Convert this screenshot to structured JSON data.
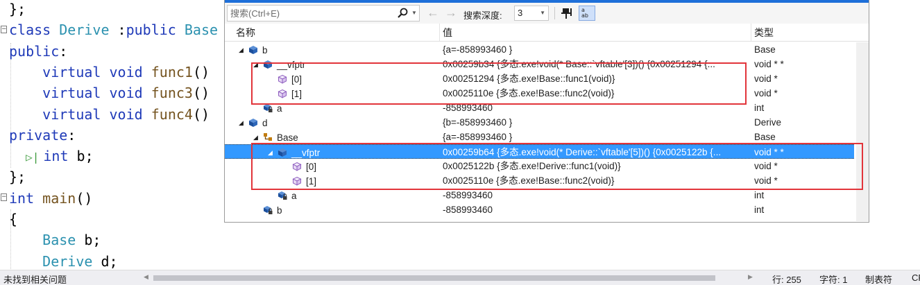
{
  "editor": {
    "lines": [
      [
        {
          "t": "};",
          "c": ""
        }
      ],
      [
        {
          "t": "class ",
          "c": "kw"
        },
        {
          "t": "Derive",
          "c": "tp"
        },
        {
          "t": " :",
          "c": ""
        },
        {
          "t": "public",
          "c": "kw"
        },
        {
          "t": " ",
          "c": ""
        },
        {
          "t": "Base",
          "c": "tp"
        }
      ],
      [
        {
          "t": "public",
          "c": "kw"
        },
        {
          "t": ":",
          "c": ""
        }
      ],
      [
        {
          "t": "    ",
          "c": ""
        },
        {
          "t": "virtual",
          "c": "kw"
        },
        {
          "t": " ",
          "c": ""
        },
        {
          "t": "void",
          "c": "kw"
        },
        {
          "t": " ",
          "c": ""
        },
        {
          "t": "func1",
          "c": "fn"
        },
        {
          "t": "()",
          "c": ""
        }
      ],
      [
        {
          "t": "    ",
          "c": ""
        },
        {
          "t": "virtual",
          "c": "kw"
        },
        {
          "t": " ",
          "c": ""
        },
        {
          "t": "void",
          "c": "kw"
        },
        {
          "t": " ",
          "c": ""
        },
        {
          "t": "func3",
          "c": "fn"
        },
        {
          "t": "()",
          "c": ""
        }
      ],
      [
        {
          "t": "    ",
          "c": ""
        },
        {
          "t": "virtual",
          "c": "kw"
        },
        {
          "t": " ",
          "c": ""
        },
        {
          "t": "void",
          "c": "kw"
        },
        {
          "t": " ",
          "c": ""
        },
        {
          "t": "func4",
          "c": "fn"
        },
        {
          "t": "()",
          "c": ""
        }
      ],
      [
        {
          "t": "private",
          "c": "kw"
        },
        {
          "t": ":",
          "c": ""
        }
      ],
      [
        {
          "t": "  ",
          "c": ""
        },
        {
          "t": "▷|",
          "c": "bm"
        },
        {
          "t": "int",
          "c": "kw"
        },
        {
          "t": " b;",
          "c": ""
        }
      ],
      [
        {
          "t": "};",
          "c": ""
        }
      ],
      [
        {
          "t": "int",
          "c": "kw"
        },
        {
          "t": " ",
          "c": ""
        },
        {
          "t": "main",
          "c": "fn"
        },
        {
          "t": "()",
          "c": ""
        }
      ],
      [
        {
          "t": "{",
          "c": ""
        }
      ],
      [
        {
          "t": "    ",
          "c": ""
        },
        {
          "t": "Base",
          "c": "tp"
        },
        {
          "t": " b;",
          "c": ""
        }
      ],
      [
        {
          "t": "    ",
          "c": ""
        },
        {
          "t": "Derive",
          "c": "tp"
        },
        {
          "t": " d;",
          "c": ""
        }
      ]
    ]
  },
  "watch": {
    "search_placeholder": "搜索(Ctrl+E)",
    "depth_label": "搜索深度:",
    "depth_value": "3",
    "columns": {
      "name": "名称",
      "value": "值",
      "type": "类型"
    },
    "rows": [
      {
        "indent": 0,
        "expander": "◢",
        "icon": "object-icon",
        "name": "b",
        "value": "{a=-858993460 }",
        "type": "Base",
        "selected": false
      },
      {
        "indent": 1,
        "expander": "◢",
        "icon": "object-icon",
        "name": "__vfptr",
        "value": "0x00259b34 {多态.exe!void(* Base::`vftable'[3])() {0x00251294 {...",
        "type": "void * *",
        "selected": false
      },
      {
        "indent": 2,
        "expander": "",
        "icon": "cube-icon",
        "name": "[0]",
        "value": "0x00251294 {多态.exe!Base::func1(void)}",
        "type": "void *",
        "selected": false
      },
      {
        "indent": 2,
        "expander": "",
        "icon": "cube-icon",
        "name": "[1]",
        "value": "0x0025110e {多态.exe!Base::func2(void)}",
        "type": "void *",
        "selected": false
      },
      {
        "indent": 1,
        "expander": "",
        "icon": "private-field-icon",
        "name": "a",
        "value": "-858993460",
        "type": "int",
        "selected": false
      },
      {
        "indent": 0,
        "expander": "◢",
        "icon": "object-icon",
        "name": "d",
        "value": "{b=-858993460 }",
        "type": "Derive",
        "selected": false
      },
      {
        "indent": 1,
        "expander": "◢",
        "icon": "base-class-icon",
        "name": "Base",
        "value": "{a=-858993460 }",
        "type": "Base",
        "selected": false
      },
      {
        "indent": 2,
        "expander": "◢",
        "icon": "object-icon",
        "name": "__vfptr",
        "value": "0x00259b64 {多态.exe!void(* Derive::`vftable'[5])() {0x0025122b {...",
        "type": "void * *",
        "selected": true
      },
      {
        "indent": 3,
        "expander": "",
        "icon": "cube-icon",
        "name": "[0]",
        "value": "0x0025122b {多态.exe!Derive::func1(void)}",
        "type": "void *",
        "selected": false
      },
      {
        "indent": 3,
        "expander": "",
        "icon": "cube-icon",
        "name": "[1]",
        "value": "0x0025110e {多态.exe!Base::func2(void)}",
        "type": "void *",
        "selected": false
      },
      {
        "indent": 2,
        "expander": "",
        "icon": "private-field-icon",
        "name": "a",
        "value": "-858993460",
        "type": "int",
        "selected": false
      },
      {
        "indent": 1,
        "expander": "",
        "icon": "private-field-icon",
        "name": "b",
        "value": "-858993460",
        "type": "int",
        "selected": false
      }
    ],
    "highlight_color": "#e2343a",
    "selection_color": "#3399ff"
  },
  "status": {
    "message": "未找到相关问题",
    "line": "行: 255",
    "column": "字符: 1",
    "indent_mode": "制表符",
    "line_ending": "CR"
  }
}
